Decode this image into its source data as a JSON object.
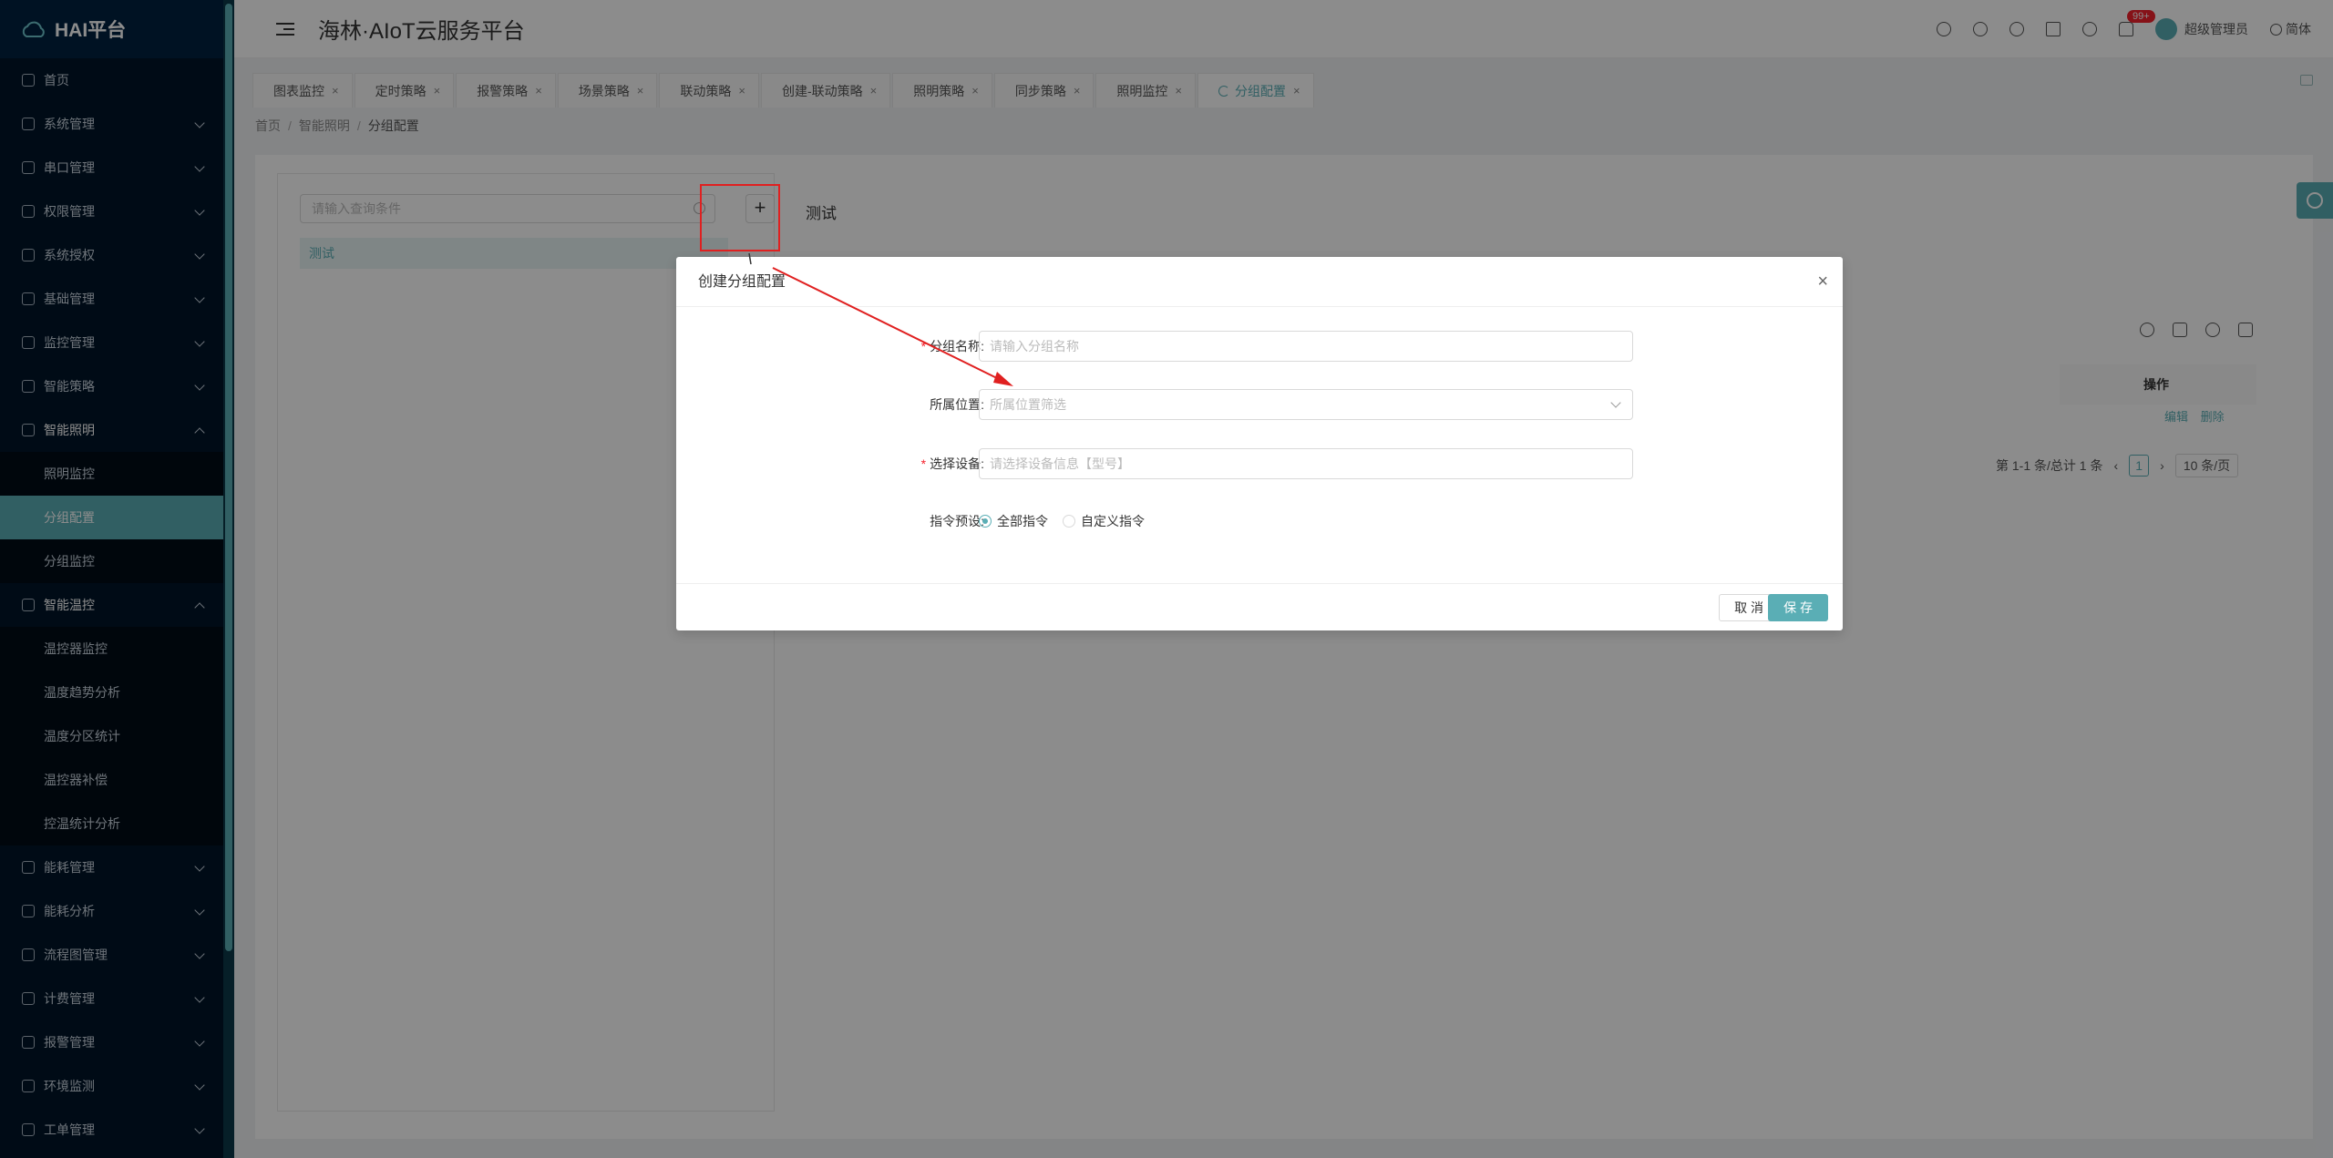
{
  "app": {
    "logo_text": "HAI平台",
    "header_title": "海林·AIoT云服务平台",
    "notification_badge": "99+",
    "user_name": "超级管理员",
    "language": "简体"
  },
  "sidebar": {
    "items": [
      {
        "label": "首页"
      },
      {
        "label": "系统管理"
      },
      {
        "label": "串口管理"
      },
      {
        "label": "权限管理"
      },
      {
        "label": "系统授权"
      },
      {
        "label": "基础管理"
      },
      {
        "label": "监控管理"
      },
      {
        "label": "智能策略"
      },
      {
        "label": "智能照明"
      },
      {
        "label": "照明监控"
      },
      {
        "label": "分组配置"
      },
      {
        "label": "分组监控"
      },
      {
        "label": "智能温控"
      },
      {
        "label": "温控器监控"
      },
      {
        "label": "温度趋势分析"
      },
      {
        "label": "温度分区统计"
      },
      {
        "label": "温控器补偿"
      },
      {
        "label": "控温统计分析"
      },
      {
        "label": "能耗管理"
      },
      {
        "label": "能耗分析"
      },
      {
        "label": "流程图管理"
      },
      {
        "label": "计费管理"
      },
      {
        "label": "报警管理"
      },
      {
        "label": "环境监测"
      },
      {
        "label": "工单管理"
      }
    ]
  },
  "tabs": [
    {
      "label": "图表监控"
    },
    {
      "label": "定时策略"
    },
    {
      "label": "报警策略"
    },
    {
      "label": "场景策略"
    },
    {
      "label": "联动策略"
    },
    {
      "label": "创建-联动策略"
    },
    {
      "label": "照明策略"
    },
    {
      "label": "同步策略"
    },
    {
      "label": "照明监控"
    },
    {
      "label": "分组配置"
    }
  ],
  "breadcrumb": {
    "home": "首页",
    "parent": "智能照明",
    "current": "分组配置"
  },
  "left_panel": {
    "search_placeholder": "请输入查询条件",
    "add_symbol": "+",
    "tree_node": "测试"
  },
  "right_panel": {
    "title": "测试",
    "col_operation": "操作",
    "edit_label": "编辑",
    "delete_label": "删除",
    "pagination_total": "第 1-1 条/总计 1 条",
    "current_page": "1",
    "page_size": "10 条/页"
  },
  "modal": {
    "title": "创建分组配置",
    "close_symbol": "×",
    "group_name_label": "分组名称:",
    "group_name_placeholder": "请输入分组名称",
    "location_label": "所属位置:",
    "location_placeholder": "所属位置筛选",
    "device_label": "选择设备:",
    "device_placeholder": "请选择设备信息【型号】",
    "preset_label": "指令预设:",
    "radio_all": "全部指令",
    "radio_custom": "自定义指令",
    "cancel_label": "取 消",
    "save_label": "保 存"
  },
  "colors": {
    "accent": "#5aaeb5",
    "sidebar_bg": "#001529",
    "annotation_red": "#e02020"
  }
}
